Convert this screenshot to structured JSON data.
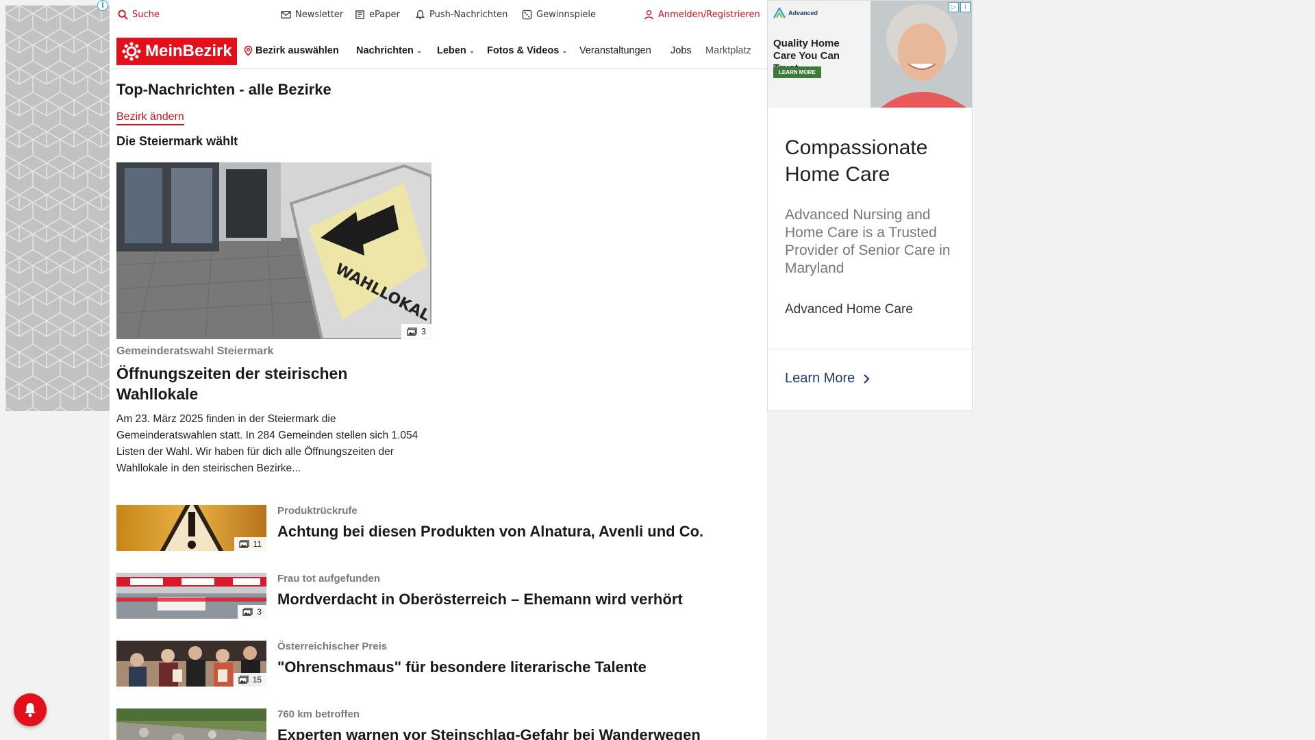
{
  "topbar": {
    "search": "Suche",
    "newsletter": "Newsletter",
    "epaper": "ePaper",
    "push": "Push-Nachrichten",
    "gewinnspiele": "Gewinnspiele",
    "login": "Anmelden/Registrieren"
  },
  "nav": {
    "logo": "MeinBezirk",
    "bezirk": "Bezirk auswählen",
    "items": [
      "Nachrichten",
      "Leben",
      "Fotos & Videos",
      "Veranstaltungen",
      "Jobs",
      "Marktplatz"
    ]
  },
  "page": {
    "title": "Top-Nachrichten - alle Bezirke",
    "change_link": "Bezirk ändern",
    "section": "Die Steiermark wählt"
  },
  "hero": {
    "image_label": "WAHLLOKAL",
    "photo_count": "3",
    "kicker": "Gemeinderatswahl Steiermark",
    "title": "Öffnungszeiten der steirischen Wahllokale",
    "teaser": "Am 23. März 2025 finden in der Steiermark die Gemeinderatswahlen statt. In 284 Gemeinden stellen sich 1.054 Listen der Wahl. Wir haben für dich alle Öffnungszeiten der Wahllokale in den steirischen Bezirke..."
  },
  "articles": [
    {
      "kicker": "Produktrückrufe",
      "title": "Achtung bei diesen Produkten von Alnatura, Avenli und Co.",
      "count": "11"
    },
    {
      "kicker": "Frau tot aufgefunden",
      "title": "Mordverdacht in Oberösterreich – Ehemann wird verhört",
      "count": "3"
    },
    {
      "kicker": "Österreichischer Preis",
      "title": "\"Ohrenschmaus\" für besondere literarische Talente",
      "count": "15"
    },
    {
      "kicker": "760 km betroffen",
      "title": "Experten warnen vor Steinschlag-Gefahr bei Wanderwegen",
      "count": ""
    }
  ],
  "ad": {
    "brand": "Advanced",
    "slogan": "Quality Home Care You Can Trust",
    "small_cta": "LEARN MORE",
    "headline": "Compassionate Home Care",
    "body": "Advanced Nursing and Home Care is a Trusted Provider of Senior Care in Maryland",
    "advertiser": "Advanced Home Care",
    "cta": "Learn More"
  },
  "colors": {
    "brand_red": "#e2101a",
    "link_red": "#d0101a",
    "ad_blue": "#1b3b6f"
  }
}
